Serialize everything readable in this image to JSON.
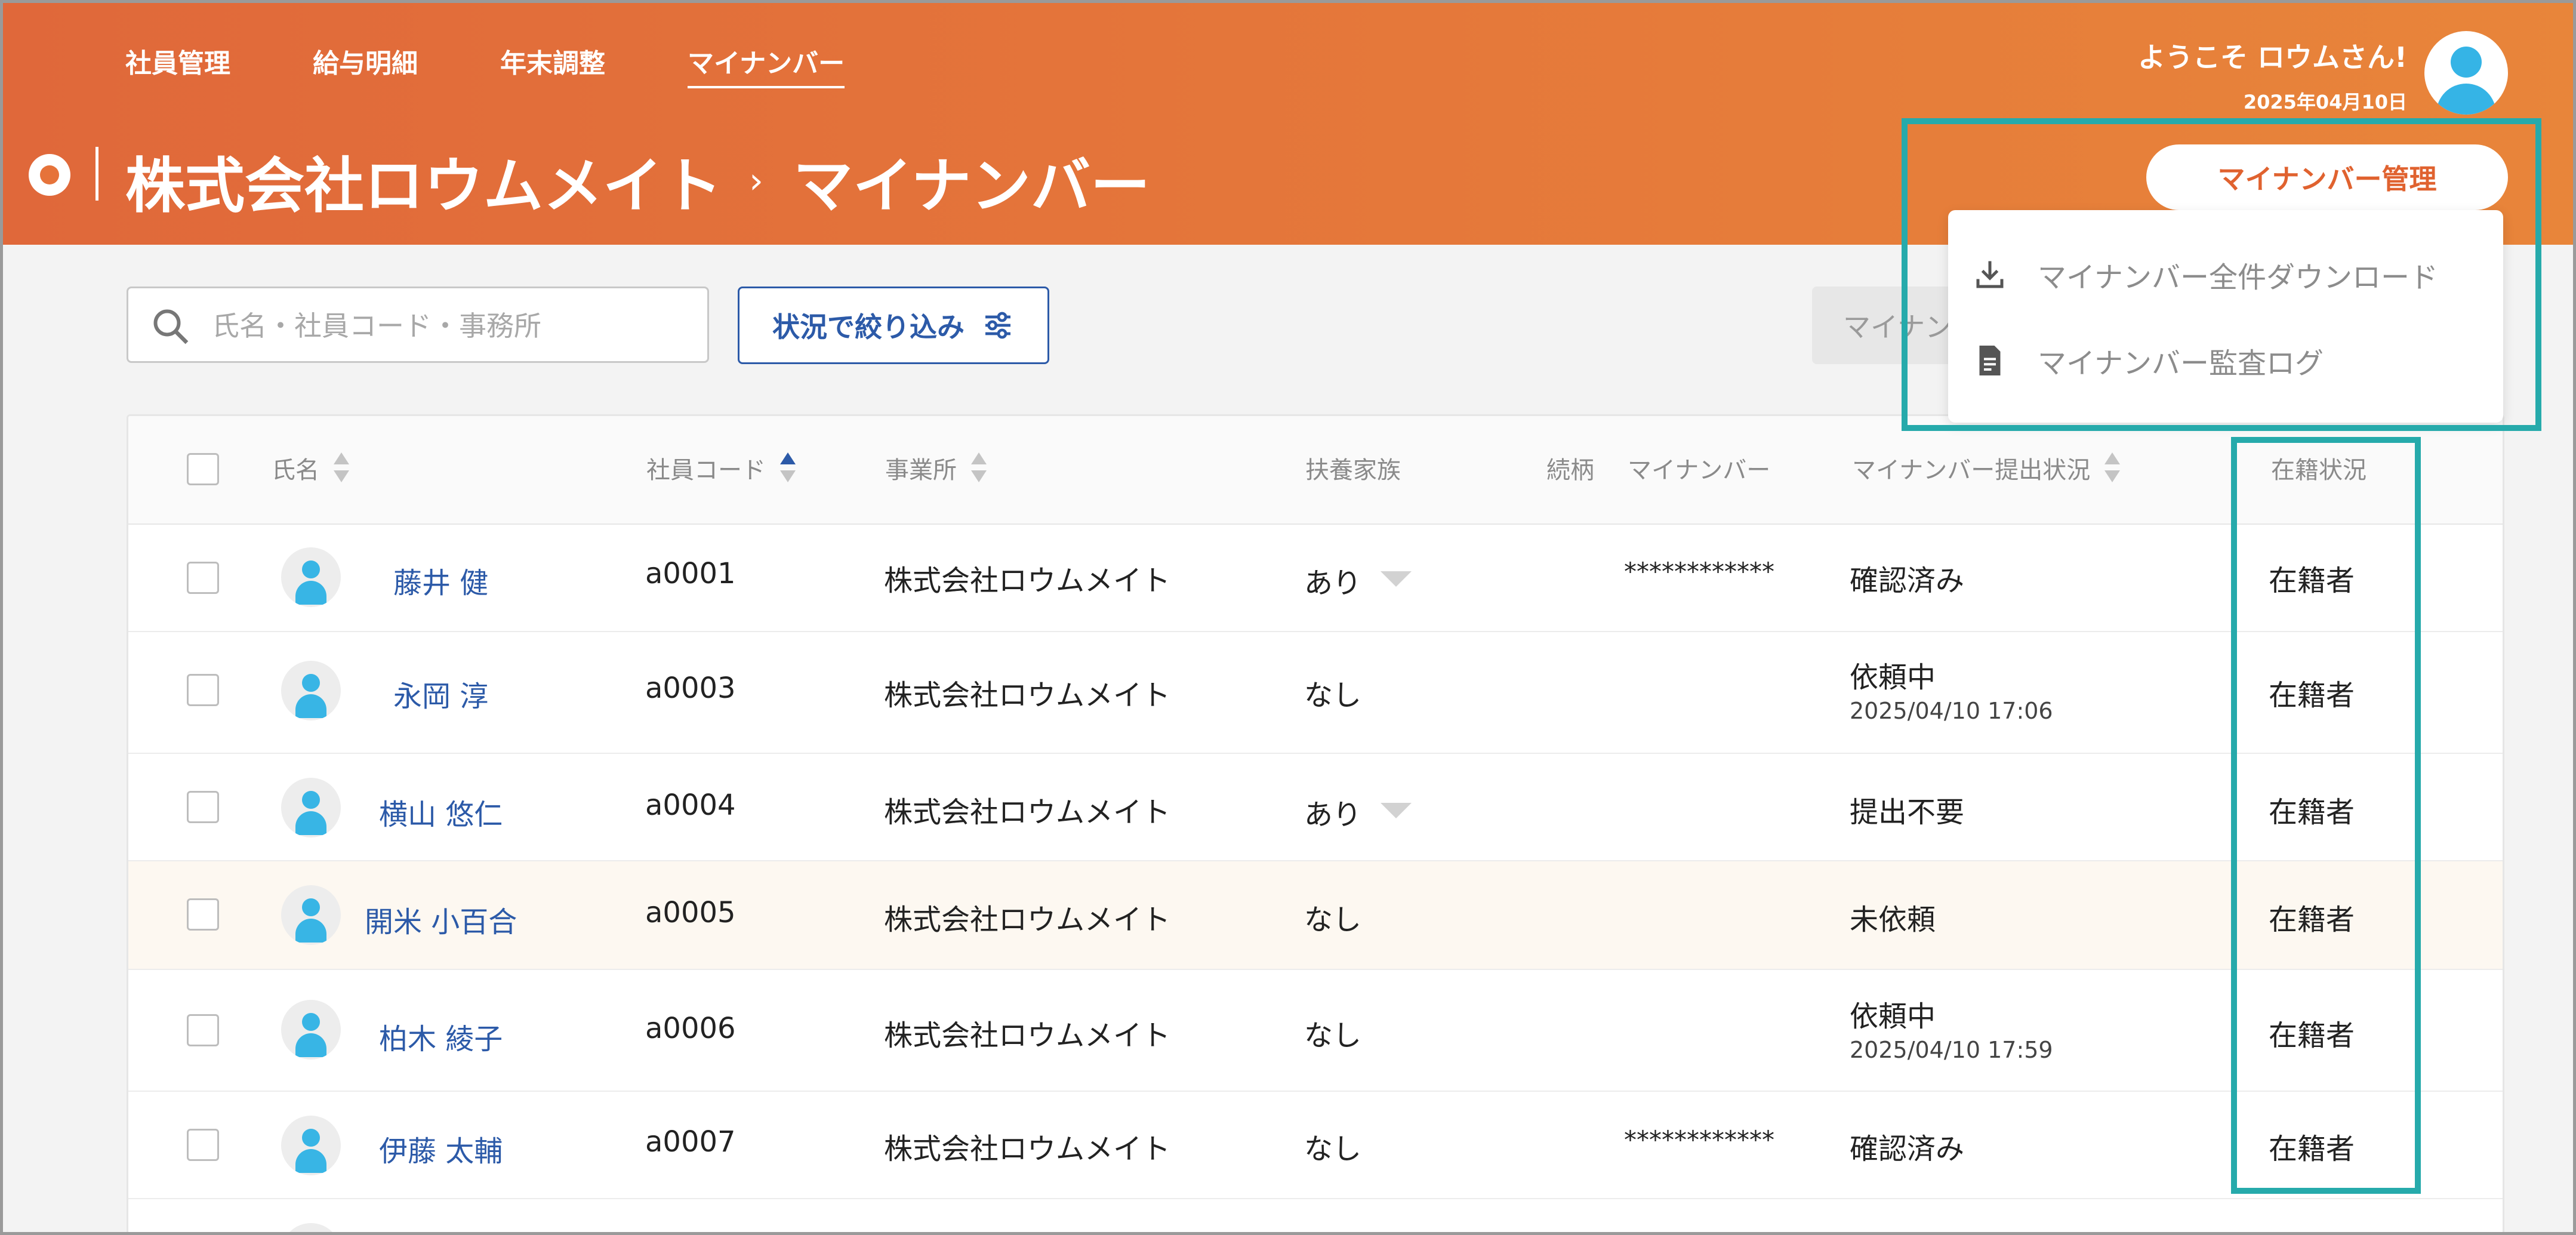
{
  "nav": {
    "items": [
      {
        "label": "社員管理"
      },
      {
        "label": "給与明細"
      },
      {
        "label": "年末調整"
      },
      {
        "label": "マイナンバー"
      }
    ]
  },
  "header": {
    "company": "株式会社ロウムメイト",
    "separator": "›",
    "page": "マイナンバー",
    "welcome": "ようこそ ロウムさん!",
    "date": "2025年04月10日",
    "mgmt_button": "マイナンバー管理"
  },
  "dropdown": {
    "items": [
      {
        "label": "マイナンバー全件ダウンロード",
        "icon": "download-icon"
      },
      {
        "label": "マイナンバー監査ログ",
        "icon": "document-icon"
      }
    ]
  },
  "toolbar": {
    "search_placeholder": "氏名・社員コード・事務所",
    "filter_label": "状況で絞り込み",
    "partial_button": "マイナンバー"
  },
  "table": {
    "headers": {
      "name": "氏名",
      "code": "社員コード",
      "office": "事業所",
      "dependents": "扶養家族",
      "relation": "続柄",
      "mynumber": "マイナンバー",
      "status": "マイナンバー提出状況",
      "employment": "在籍状況"
    },
    "rows": [
      {
        "name": "藤井 健",
        "code": "a0001",
        "office": "株式会社ロウムメイト",
        "dependents": "あり",
        "mynumber": "************",
        "status": "確認済み",
        "status_time": "",
        "employment": "在籍者"
      },
      {
        "name": "永岡 淳",
        "code": "a0003",
        "office": "株式会社ロウムメイト",
        "dependents": "なし",
        "mynumber": "",
        "status": "依頼中",
        "status_time": "2025/04/10 17:06",
        "employment": "在籍者"
      },
      {
        "name": "横山 悠仁",
        "code": "a0004",
        "office": "株式会社ロウムメイト",
        "dependents": "あり",
        "mynumber": "",
        "status": "提出不要",
        "status_time": "",
        "employment": "在籍者"
      },
      {
        "name": "開米 小百合",
        "code": "a0005",
        "office": "株式会社ロウムメイト",
        "dependents": "なし",
        "mynumber": "",
        "status": "未依頼",
        "status_time": "",
        "employment": "在籍者"
      },
      {
        "name": "柏木 綾子",
        "code": "a0006",
        "office": "株式会社ロウムメイト",
        "dependents": "なし",
        "mynumber": "",
        "status": "依頼中",
        "status_time": "2025/04/10 17:59",
        "employment": "在籍者"
      },
      {
        "name": "伊藤 太輔",
        "code": "a0007",
        "office": "株式会社ロウムメイト",
        "dependents": "なし",
        "mynumber": "************",
        "status": "確認済み",
        "status_time": "",
        "employment": "在籍者"
      }
    ]
  },
  "colors": {
    "header_start": "#e0683a",
    "header_end": "#e8853a",
    "accent_blue": "#2c5aa8",
    "highlight": "#26aaab"
  }
}
